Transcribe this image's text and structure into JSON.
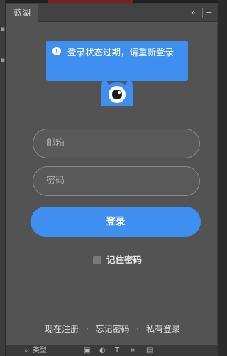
{
  "panel": {
    "tab_label": "蓝湖",
    "expand_glyph": "»",
    "menu_glyph": "≡"
  },
  "toast": {
    "icon": "info-icon",
    "message": "登录状态过期，请重新登录"
  },
  "logo": {
    "icon": "lanhu-mascot-logo"
  },
  "form": {
    "email_placeholder": "邮箱",
    "password_placeholder": "密码",
    "login_label": "登录",
    "remember_label": "记住密码",
    "remember_checked": false
  },
  "footer": {
    "register": "现在注册",
    "forgot": "忘记密码",
    "private": "私有登录",
    "separator": "·"
  },
  "host_bottom": {
    "kind_filter": "类型"
  },
  "colors": {
    "accent": "#3f8ff0",
    "panel_bg": "#535353",
    "text_light": "#e8e8e8"
  }
}
